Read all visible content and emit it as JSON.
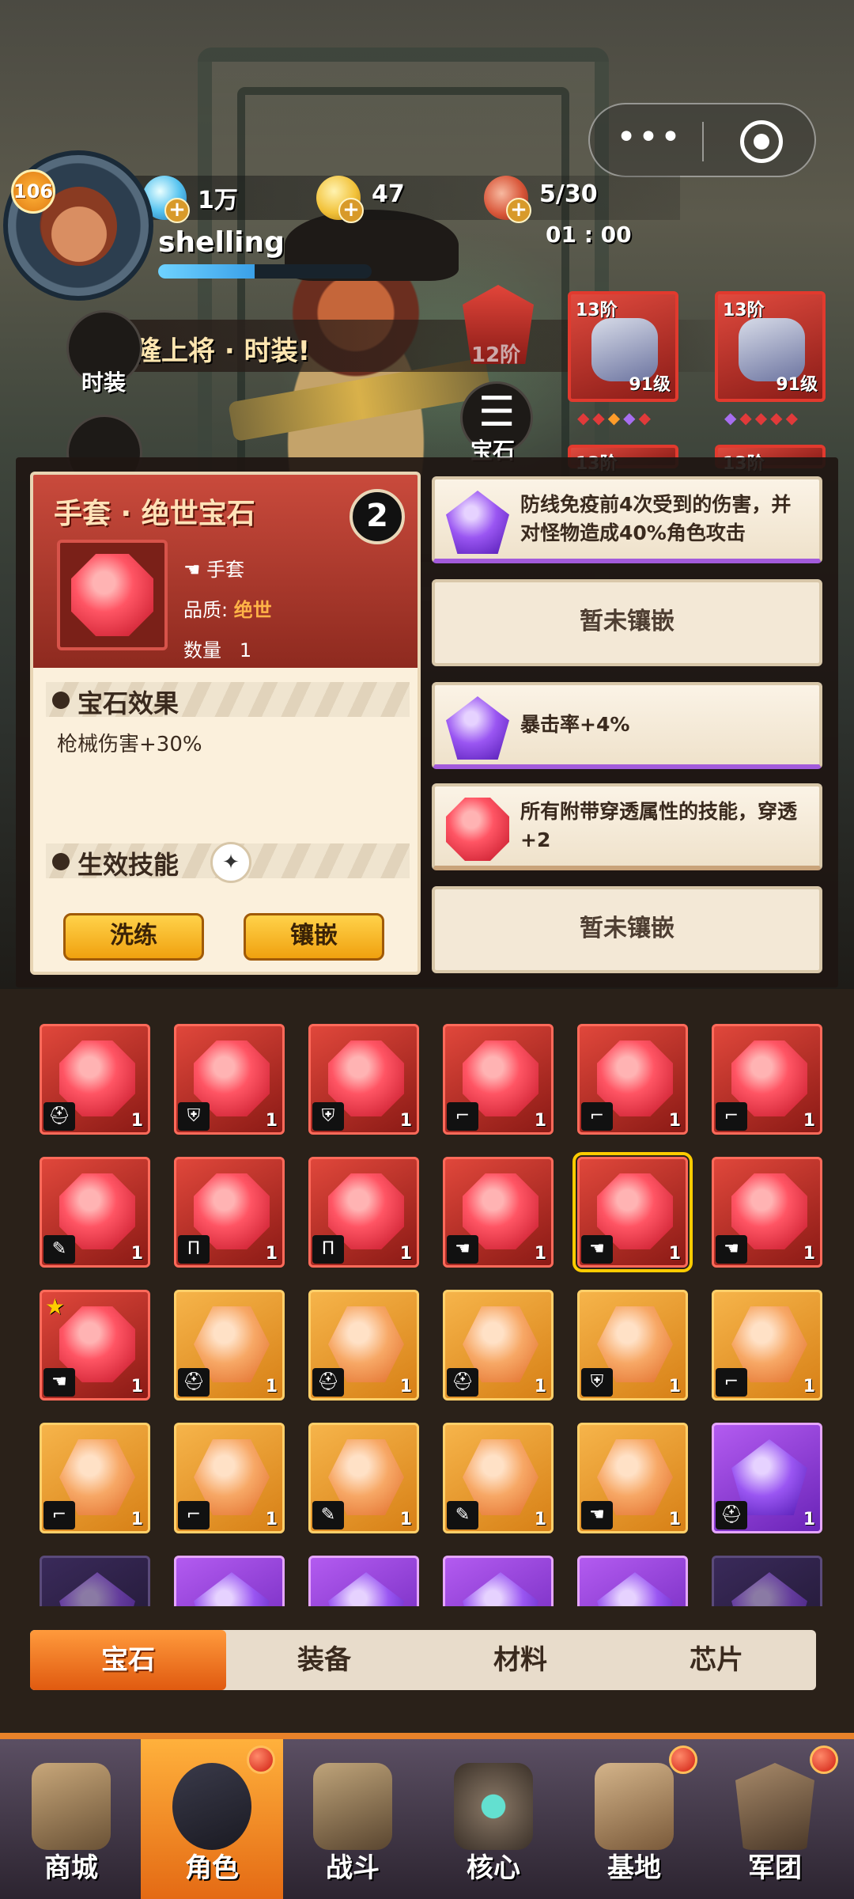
{
  "player": {
    "level": "106",
    "name": "shelling",
    "xp_fraction": 0.45
  },
  "resources": {
    "gems": "1万",
    "coins": "47",
    "stamina": "5/30",
    "stamina_timer": "01 : 00"
  },
  "capsule": {
    "menu_icon": "•••",
    "close_icon": "target-icon"
  },
  "side": {
    "fashion_label": "时装",
    "banner_text": "隆上将 · 时装!",
    "rank_label": "12阶",
    "list_label": "宝石"
  },
  "equipment": [
    {
      "tier": "13阶",
      "level": "91级",
      "diamonds": "◆◆◆◆◆",
      "colors": [
        "#e03a3a",
        "#e03a3a",
        "#ff9c2a",
        "#a76ef0",
        "#e03a3a"
      ]
    },
    {
      "tier": "13阶",
      "level": "91级",
      "diamonds": "◆◆◆◆◆",
      "colors": [
        "#a76ef0",
        "#e03a3a",
        "#e03a3a",
        "#e03a3a",
        "#e03a3a"
      ]
    },
    {
      "tier": "13阶"
    },
    {
      "tier": "13阶"
    }
  ],
  "card": {
    "title": "手套 · 绝世宝石",
    "slot_type": "手套",
    "quality_label": "品质:",
    "quality_value": "绝世",
    "quantity_label": "数量",
    "quantity_value": "1",
    "swap_icon": "2",
    "effect_header": "宝石效果",
    "effect_text": "枪械伤害+30%",
    "skill_header": "生效技能",
    "btn_refine": "洗练",
    "btn_inlay": "镶嵌"
  },
  "slots": [
    {
      "type": "purple",
      "text": "防线免疫前4次受到的伤害，并对怪物造成40%角色攻击"
    },
    {
      "type": "empty",
      "text": "暂未镶嵌"
    },
    {
      "type": "purple",
      "text": "暴击率+4%"
    },
    {
      "type": "red",
      "text": "所有附带穿透属性的技能，穿透+2"
    },
    {
      "type": "empty",
      "text": "暂未镶嵌"
    }
  ],
  "grid": [
    {
      "c": "red",
      "p": "helmet",
      "n": "1"
    },
    {
      "c": "red",
      "p": "armor",
      "n": "1"
    },
    {
      "c": "red",
      "p": "armor",
      "n": "1"
    },
    {
      "c": "red",
      "p": "boots",
      "n": "1"
    },
    {
      "c": "red",
      "p": "boots",
      "n": "1"
    },
    {
      "c": "red",
      "p": "boots",
      "n": "1"
    },
    {
      "c": "red",
      "p": "arm",
      "n": "1"
    },
    {
      "c": "red",
      "p": "pants",
      "n": "1"
    },
    {
      "c": "red",
      "p": "pants",
      "n": "1"
    },
    {
      "c": "red",
      "p": "glove",
      "n": "1"
    },
    {
      "c": "red",
      "p": "glove",
      "n": "1",
      "sel": true
    },
    {
      "c": "red",
      "p": "glove",
      "n": "1"
    },
    {
      "c": "red",
      "p": "glove",
      "n": "1",
      "star": true
    },
    {
      "c": "orange",
      "p": "helmet",
      "n": "1"
    },
    {
      "c": "orange",
      "p": "helmet",
      "n": "1"
    },
    {
      "c": "orange",
      "p": "helmet",
      "n": "1"
    },
    {
      "c": "orange",
      "p": "armor",
      "n": "1"
    },
    {
      "c": "orange",
      "p": "boots",
      "n": "1"
    },
    {
      "c": "orange",
      "p": "boots",
      "n": "1"
    },
    {
      "c": "orange",
      "p": "boots",
      "n": "1"
    },
    {
      "c": "orange",
      "p": "arm",
      "n": "1"
    },
    {
      "c": "orange",
      "p": "arm",
      "n": "1"
    },
    {
      "c": "orange",
      "p": "glove",
      "n": "1"
    },
    {
      "c": "purple",
      "p": "helmet",
      "n": "1"
    },
    {
      "c": "dark",
      "p": "",
      "n": ""
    },
    {
      "c": "purple",
      "p": "",
      "n": ""
    },
    {
      "c": "purple",
      "p": "",
      "n": ""
    },
    {
      "c": "purple",
      "p": "",
      "n": ""
    },
    {
      "c": "purple",
      "p": "",
      "n": ""
    },
    {
      "c": "dark",
      "p": "",
      "n": ""
    }
  ],
  "tabs": [
    "宝石",
    "装备",
    "材料",
    "芯片"
  ],
  "nav": [
    {
      "label": "商城",
      "icon": "shop-icon",
      "badge": false
    },
    {
      "label": "角色",
      "icon": "character-icon",
      "badge": true,
      "active": true
    },
    {
      "label": "战斗",
      "icon": "battle-icon",
      "badge": false
    },
    {
      "label": "核心",
      "icon": "core-icon",
      "badge": false
    },
    {
      "label": "基地",
      "icon": "base-icon",
      "badge": true
    },
    {
      "label": "军团",
      "icon": "legion-icon",
      "badge": true
    }
  ]
}
